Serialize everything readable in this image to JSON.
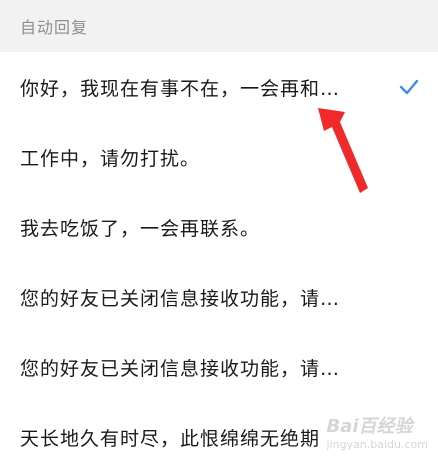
{
  "header": {
    "title": "自动回复"
  },
  "replies": [
    {
      "text": "你好，我现在有事不在，一会再和…",
      "selected": true
    },
    {
      "text": "工作中，请勿打扰。",
      "selected": false
    },
    {
      "text": "我去吃饭了，一会再联系。",
      "selected": false
    },
    {
      "text": "您的好友已关闭信息接收功能，请…",
      "selected": false
    },
    {
      "text": "您的好友已关闭信息接收功能，请…",
      "selected": false
    },
    {
      "text": "天长地久有时尽，此恨绵绵无绝期",
      "selected": false
    }
  ],
  "colors": {
    "check": "#3d8ee8",
    "annotation_arrow": "#f02a2a"
  },
  "watermark": {
    "text": "Bai百经验",
    "sub": "jingyan.baidu.com"
  }
}
